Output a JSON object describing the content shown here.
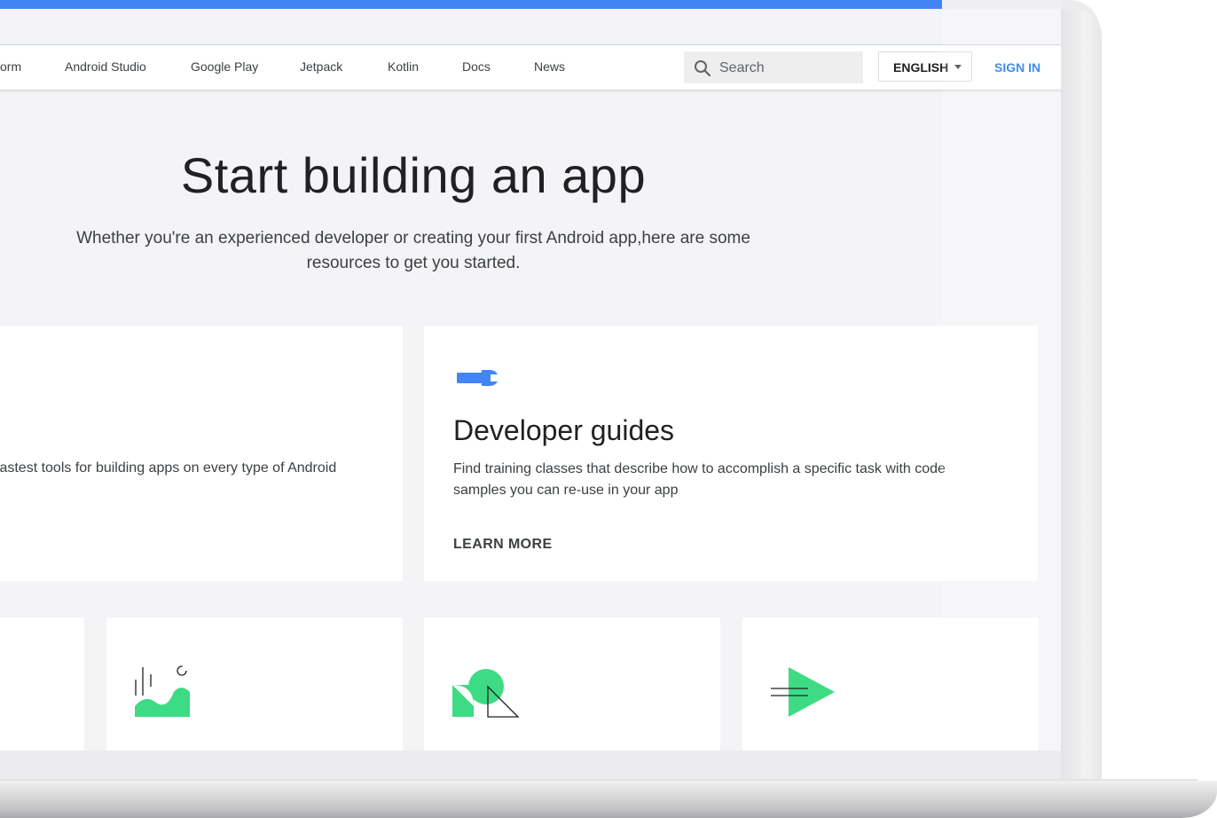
{
  "nav": {
    "items": [
      {
        "label": "orm"
      },
      {
        "label": "Android Studio"
      },
      {
        "label": "Google Play"
      },
      {
        "label": "Jetpack"
      },
      {
        "label": "Kotlin"
      },
      {
        "label": "Docs"
      },
      {
        "label": "News"
      }
    ],
    "search_placeholder": "Search",
    "language": "ENGLISH",
    "sign_in": "SIGN IN"
  },
  "hero": {
    "title": "Start building an app",
    "subtitle_line1": "Whether you're an experienced developer or creating your first Android app,here are some",
    "subtitle_line2": "resources to get you started."
  },
  "cards": {
    "left": {
      "description": "fastest tools for building apps on every type of Android"
    },
    "right": {
      "icon": "wrench-icon",
      "title": "Developer guides",
      "description": "Find training classes that describe how to accomplish a specific task with code samples you can re-use in your app",
      "link": "LEARN MORE"
    }
  },
  "small_cards": [
    {
      "icon": "chart-icon"
    },
    {
      "icon": "shapes-icon"
    },
    {
      "icon": "play-arrow-icon"
    }
  ],
  "colors": {
    "accent_blue": "#4285f4",
    "link_blue": "#1a73e8",
    "icon_green": "#3ddc84",
    "background": "#f4f4f7"
  }
}
